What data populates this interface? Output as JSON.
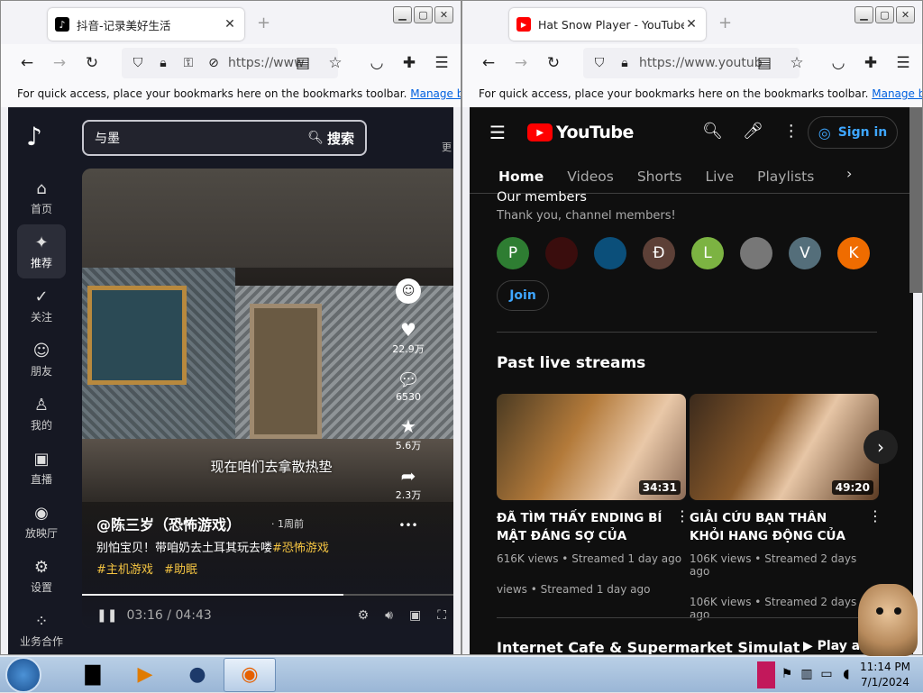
{
  "left_window": {
    "tab_title": "抖音-记录美好生活",
    "url_text": "https://www",
    "bookmarks_text": "For quick access, place your bookmarks here on the bookmarks toolbar.",
    "bookmarks_link": "Manage bookmarks",
    "douyin": {
      "search_query": "与墨",
      "search_button": "搜索",
      "right_cut_label": "更",
      "sidebar": [
        {
          "icon": "home-icon",
          "glyph": "⌂",
          "label": "首页"
        },
        {
          "icon": "sparkle-icon",
          "glyph": "✦",
          "label": "推荐"
        },
        {
          "icon": "follow-icon",
          "glyph": "✓",
          "label": "关注"
        },
        {
          "icon": "friends-icon",
          "glyph": "☺",
          "label": "朋友"
        },
        {
          "icon": "me-icon",
          "glyph": "♙",
          "label": "我的"
        },
        {
          "icon": "live-icon",
          "glyph": "▣",
          "label": "直播"
        },
        {
          "icon": "game-icon",
          "glyph": "◉",
          "label": "放映厅"
        },
        {
          "icon": "settings-icon",
          "glyph": "⚙",
          "label": "设置"
        },
        {
          "icon": "apps-icon",
          "glyph": "⁘",
          "label": "业务合作"
        }
      ],
      "video": {
        "subtitle": "现在咱们去拿散热垫",
        "author": "@陈三岁（恐怖游戏）",
        "posted": "· 1周前",
        "description": "别怕宝贝！带咱奶去土耳其玩去喽",
        "description_tag": "#恐怖游戏",
        "tags": [
          "#主机游戏",
          "#助眠"
        ],
        "time_current": "03:16",
        "time_sep": " / ",
        "time_total": "04:43",
        "progress": 0.69,
        "likes": "22.9万",
        "comments": "6530",
        "favorites": "5.6万",
        "shares": "2.3万",
        "more": "•••"
      }
    }
  },
  "right_window": {
    "tab_title": "Hat Snow Player - YouTube",
    "url_text": "https://www.youtub",
    "bookmarks_text": "For quick access, place your bookmarks here on the bookmarks toolbar.",
    "bookmarks_link": "Manage bookmarks",
    "youtube": {
      "logo_text": "YouTube",
      "sign_in": "Sign in",
      "tabs": [
        "Home",
        "Videos",
        "Shorts",
        "Live",
        "Playlists"
      ],
      "members_title": "Our members",
      "members_sub": "Thank you, channel members!",
      "members": [
        {
          "letter": "P",
          "color": "#2e7d32"
        },
        {
          "letter": "",
          "color": "#3a0d0d"
        },
        {
          "letter": "",
          "color": "#0b4f7a"
        },
        {
          "letter": "Đ",
          "color": "#5d4037"
        },
        {
          "letter": "L",
          "color": "#7cb342"
        },
        {
          "letter": "",
          "color": "#777777"
        },
        {
          "letter": "V",
          "color": "#546e7a"
        },
        {
          "letter": "K",
          "color": "#ef6c00"
        }
      ],
      "join": "Join",
      "section_title": "Past live streams",
      "videos": [
        {
          "title": "ĐÃ TÌM THẤY ENDING BÍ MẬT ĐÁNG SỢ CỦA SINH...",
          "duration": "34:31",
          "views": "616K views",
          "when": "Streamed 1 day ago",
          "views2": "views",
          "when2": "Streamed 1 day ago"
        },
        {
          "title": "GIẢI CỨU BẠN THÂN KHỎI HANG ĐỘNG CỦA ĐÀN NHỆ...",
          "duration": "49:20",
          "views": "106K views",
          "when": "Streamed 2 days ago",
          "views2": "106K views",
          "when2": "Streamed 2 days ago"
        }
      ],
      "bottom_section": "Internet Cafe & Supermarket Simulat",
      "play_all": "Play all"
    }
  },
  "taskbar": {
    "time": "11:14 PM",
    "date": "7/1/2024"
  }
}
